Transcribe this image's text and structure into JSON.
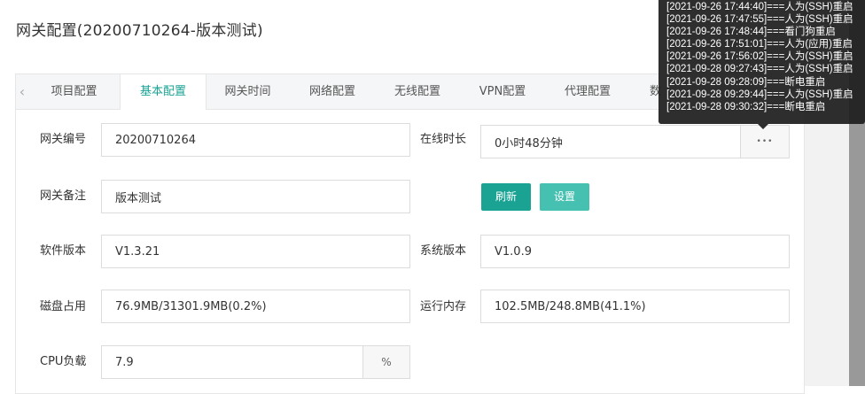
{
  "page": {
    "title": "网关配置(20200710264-版本测试)"
  },
  "tabs": [
    {
      "label": "项目配置"
    },
    {
      "label": "基本配置"
    },
    {
      "label": "网关时间"
    },
    {
      "label": "网络配置"
    },
    {
      "label": "无线配置"
    },
    {
      "label": "VPN配置"
    },
    {
      "label": "代理配置"
    },
    {
      "label": "数"
    }
  ],
  "tab_prev_glyph": "‹",
  "form": {
    "gateway_id": {
      "label": "网关编号",
      "value": "20200710264"
    },
    "online_time": {
      "label": "在线时长",
      "value": "0小时48分钟",
      "more": "•••"
    },
    "gateway_note": {
      "label": "网关备注",
      "value": "版本测试"
    },
    "refresh_btn": {
      "label": "刷新"
    },
    "settings_btn": {
      "label": "设置"
    },
    "software_ver": {
      "label": "软件版本",
      "value": "V1.3.21"
    },
    "system_ver": {
      "label": "系统版本",
      "value": "V1.0.9"
    },
    "disk_usage": {
      "label": "磁盘占用",
      "value": "76.9MB/31301.9MB(0.2%)"
    },
    "memory": {
      "label": "运行内存",
      "value": "102.5MB/248.8MB(41.1%)"
    },
    "cpu_load": {
      "label": "CPU负载",
      "value": "7.9",
      "suffix": "%"
    }
  },
  "tooltip": {
    "lines": [
      "[2021-09-26 17:44:40]===人为(SSH)重启",
      "[2021-09-26 17:47:55]===人为(SSH)重启",
      "[2021-09-26 17:48:44]===看门狗重启",
      "[2021-09-26 17:51:01]===人为(应用)重启",
      "[2021-09-26 17:56:02]===人为(SSH)重启",
      "[2021-09-28 09:27:43]===人为(SSH)重启",
      "[2021-09-28 09:28:09]===断电重启",
      "[2021-09-28 09:29:44]===人为(SSH)重启",
      "[2021-09-28 09:30:32]===断电重启"
    ]
  },
  "colors": {
    "primary": "#1aa393",
    "primary_light": "#45c0b1",
    "tab_active_text": "#1aa393"
  }
}
